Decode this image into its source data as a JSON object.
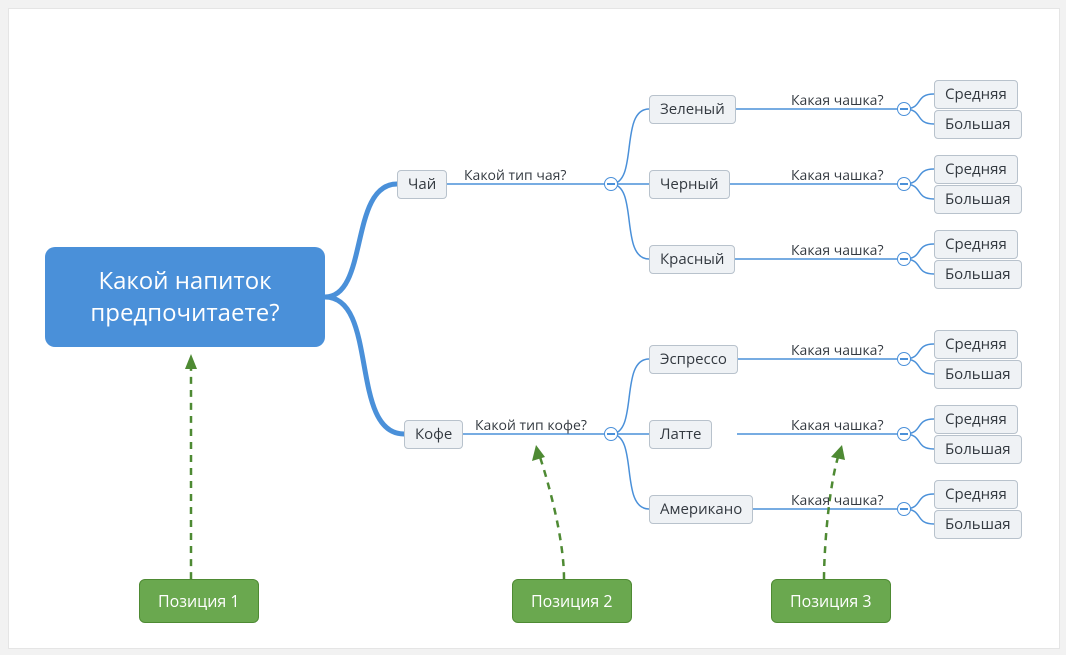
{
  "root": {
    "line1": "Какой напиток",
    "line2": "предпочитаете?"
  },
  "level1": {
    "tea": "Чай",
    "coffee": "Кофе",
    "tea_q": "Какой тип чая?",
    "coffee_q": "Какой тип кофе?"
  },
  "tea_types": {
    "green": "Зеленый",
    "black": "Черный",
    "red": "Красный"
  },
  "coffee_types": {
    "espresso": "Эспрессо",
    "latte": "Латте",
    "americano": "Американо"
  },
  "cup_q": "Какая чашка?",
  "cup": {
    "medium": "Средняя",
    "large": "Большая"
  },
  "positions": {
    "p1": "Позиция 1",
    "p2": "Позиция 2",
    "p3": "Позиция 3"
  },
  "colors": {
    "accent": "#4a90d9",
    "node_bg": "#eff2f5",
    "node_border": "#b8c2cc",
    "pos_bg": "#6aa84f",
    "pos_border": "#4e8a33"
  }
}
